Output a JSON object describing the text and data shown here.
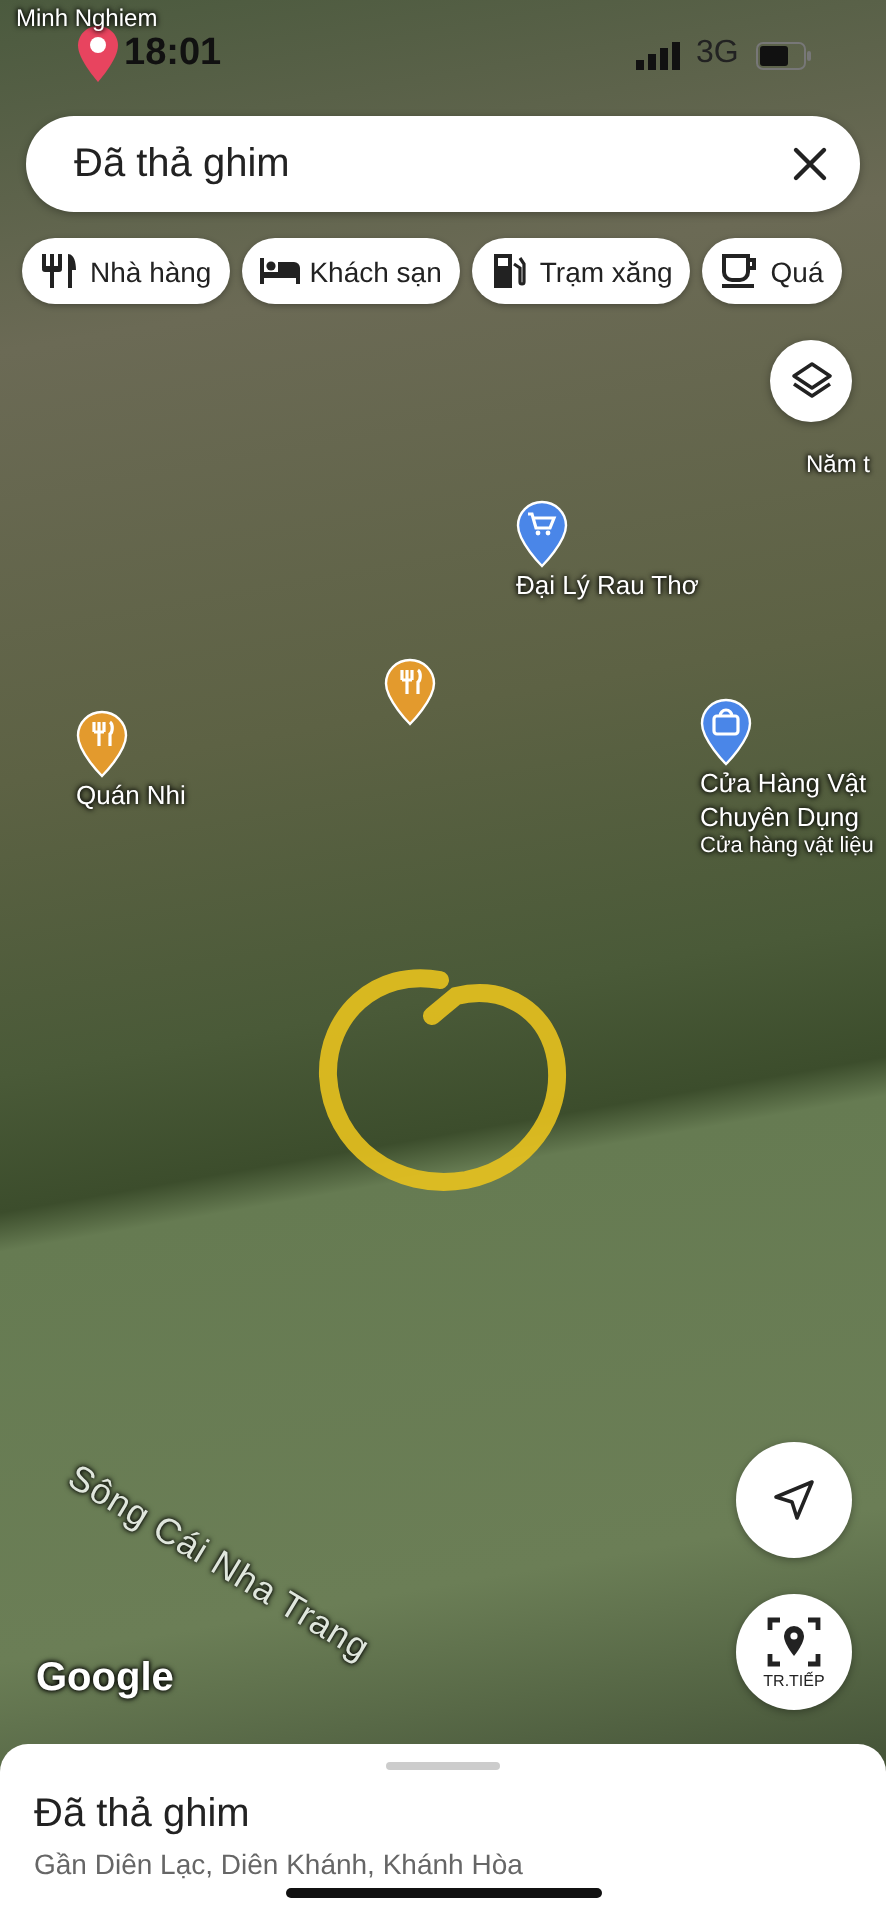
{
  "status_bar": {
    "time": "18:01",
    "network": "3G"
  },
  "search": {
    "value": "Đã thả ghim"
  },
  "chips": [
    {
      "label": "Nhà hàng",
      "kind": "restaurant"
    },
    {
      "label": "Khách sạn",
      "kind": "hotel"
    },
    {
      "label": "Trạm xăng",
      "kind": "gas"
    },
    {
      "label": "Quá",
      "kind": "cafe"
    }
  ],
  "map": {
    "places": [
      {
        "kind": "area",
        "lines": [
          "Minh Nghiem"
        ]
      },
      {
        "kind": "area",
        "lines": [
          "Năm t"
        ]
      },
      {
        "kind": "poi",
        "color": "#4a86e8",
        "lines": [
          "Đại Lý Rau Thơ"
        ]
      },
      {
        "kind": "poi",
        "color": "#e39a2d",
        "lines": [
          "Quán Nhi"
        ]
      },
      {
        "kind": "poi",
        "color": "#e39a2d"
      },
      {
        "kind": "poi",
        "color": "#4a86e8",
        "lines": [
          "Cửa Hàng Vật",
          "Chuyên Dụng"
        ],
        "category": "Cửa hàng vật liệu"
      },
      {
        "kind": "water",
        "lines": [
          "Sông Cái Nha Trang"
        ]
      }
    ],
    "attribution": "Google"
  },
  "locate_button": {
    "label": "TR.TIẾP"
  },
  "sheet": {
    "title": "Đã thả ghim",
    "subtitle": "Gần Diên Lạc, Diên Khánh, Khánh Hòa"
  }
}
